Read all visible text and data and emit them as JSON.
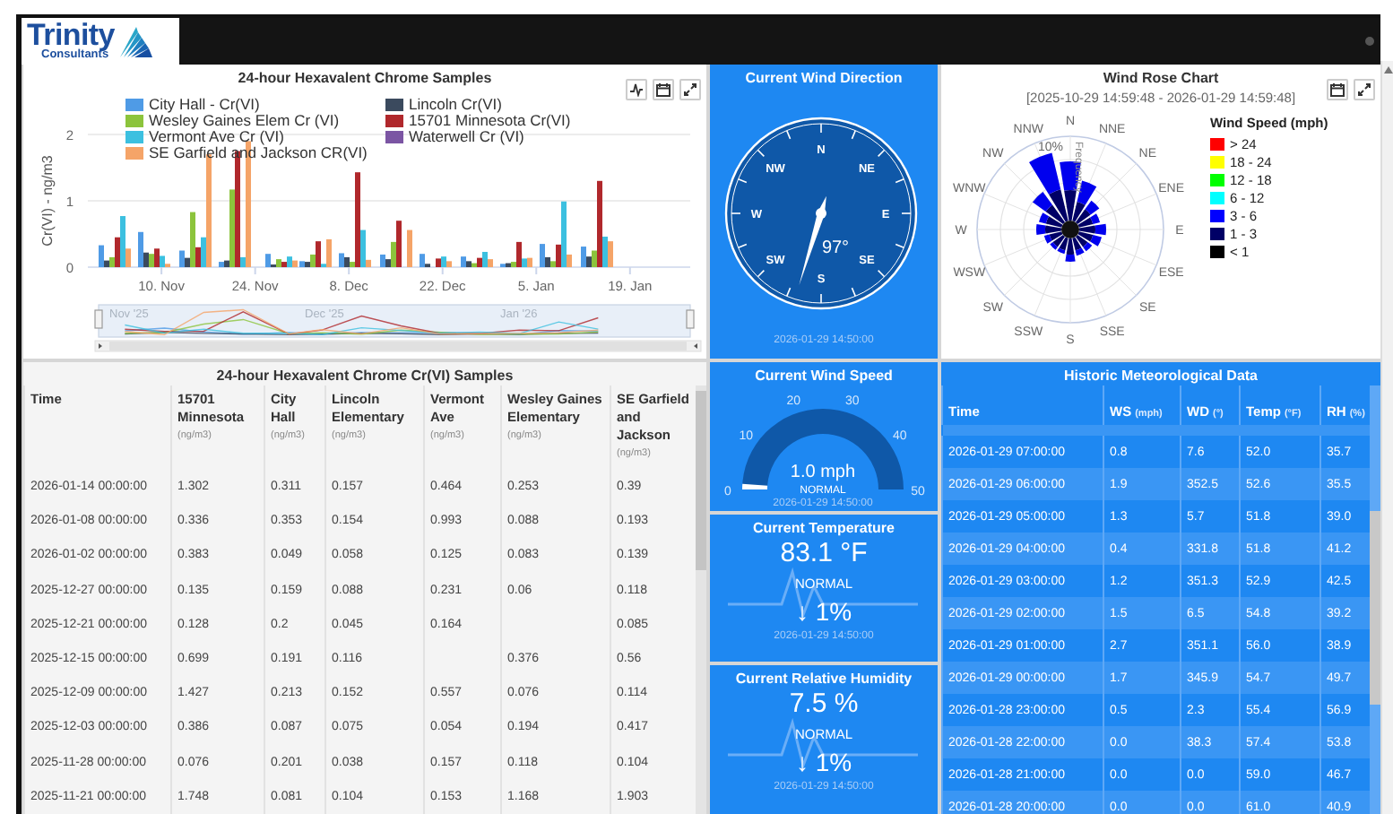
{
  "header": {
    "logo_text": "Trinity",
    "logo_subtext": "Consultants"
  },
  "samples_chart": {
    "chart_data": {
      "type": "bar",
      "title": "24-hour Hexavalent Chrome Samples",
      "ylabel": "Cr(VI) - ng/m3",
      "x": [
        "2025-11-03",
        "2025-11-09",
        "2025-11-15",
        "2025-11-21",
        "2025-11-28",
        "2025-12-03",
        "2025-12-09",
        "2025-12-15",
        "2025-12-21",
        "2025-12-27",
        "2026-01-02",
        "2026-01-08",
        "2026-01-14"
      ],
      "series": [
        {
          "name": "City Hall - Cr(VI)",
          "color": "#4f9be6",
          "values": [
            0.33,
            0.53,
            0.25,
            0.08,
            0.2,
            0.09,
            0.21,
            0.19,
            0.2,
            0.16,
            0.05,
            0.35,
            0.31
          ]
        },
        {
          "name": "Lincoln Cr(VI)",
          "color": "#3b4a5e",
          "values": [
            0.1,
            0.22,
            0.14,
            0.1,
            0.04,
            0.08,
            0.15,
            0.12,
            0.05,
            0.09,
            0.06,
            0.15,
            0.16
          ]
        },
        {
          "name": "Wesley Gaines Elem Cr (VI)",
          "color": "#8cc43c",
          "values": [
            0.15,
            0.2,
            0.83,
            1.17,
            0.12,
            0.19,
            0.08,
            0.38,
            null,
            0.06,
            0.08,
            0.09,
            0.25
          ]
        },
        {
          "name": "15701 Minnesota Cr(VI)",
          "color": "#b0282c",
          "values": [
            0.45,
            0.28,
            0.3,
            1.75,
            0.08,
            0.39,
            1.43,
            0.7,
            0.13,
            0.14,
            0.38,
            0.34,
            1.3
          ]
        },
        {
          "name": "Vermont Ave Cr (VI)",
          "color": "#3cc0e0",
          "values": [
            0.77,
            0.17,
            0.45,
            0.15,
            0.16,
            0.05,
            0.56,
            null,
            0.16,
            0.23,
            0.13,
            0.99,
            0.46
          ]
        },
        {
          "name": "Waterwell Cr (VI)",
          "color": "#7b55a3",
          "values": [
            null,
            null,
            null,
            null,
            null,
            null,
            null,
            null,
            null,
            null,
            null,
            null,
            null
          ]
        },
        {
          "name": "SE Garfield and Jackson CR(VI)",
          "color": "#f5a468",
          "values": [
            0.28,
            0.05,
            1.7,
            1.9,
            0.1,
            0.42,
            0.11,
            0.56,
            0.09,
            0.12,
            0.14,
            0.19,
            0.39
          ]
        }
      ],
      "xlim": [
        "2025-10-30",
        "2026-01-28"
      ],
      "ylim": [
        0,
        2
      ],
      "yticks": [
        0,
        1,
        2
      ],
      "xticks": [
        {
          "value": "2025-11-10",
          "label": "10. Nov"
        },
        {
          "value": "2025-11-24",
          "label": "24. Nov"
        },
        {
          "value": "2025-12-08",
          "label": "8. Dec"
        },
        {
          "value": "2025-12-22",
          "label": "22. Dec"
        },
        {
          "value": "2026-01-05",
          "label": "5. Jan"
        },
        {
          "value": "2026-01-19",
          "label": "19. Jan"
        }
      ]
    },
    "navigator_labels": [
      "Nov '25",
      "Dec '25",
      "Jan '26"
    ]
  },
  "wind_direction": {
    "title": "Current Wind Direction",
    "labels": [
      "N",
      "NE",
      "E",
      "SE",
      "S",
      "SW",
      "W",
      "NW"
    ],
    "value": "97°",
    "timestamp": "2026-01-29 14:50:00"
  },
  "wind_rose": {
    "title": "Wind Rose Chart",
    "subtitle": "[2025-10-29 14:59:48 - 2026-01-29 14:59:48]",
    "directions_right": [
      "N",
      "NNE",
      "NE",
      "ENE",
      "E",
      "ESE",
      "SE",
      "SSE",
      "S"
    ],
    "directions_left": [
      "NNW",
      "NW",
      "WNW",
      "W",
      "WSW",
      "SW",
      "SSW"
    ],
    "ring_label": "10%",
    "axis_label": "Frequency",
    "legend_title": "Wind Speed (mph)",
    "legend": [
      {
        "label": "> 24",
        "color": "#ff0000"
      },
      {
        "label": "18 - 24",
        "color": "#ffff00"
      },
      {
        "label": "12 - 18",
        "color": "#00ff00"
      },
      {
        "label": "6 - 12",
        "color": "#00ffff"
      },
      {
        "label": "3 - 6",
        "color": "#0000ff"
      },
      {
        "label": "1 - 3",
        "color": "#000066"
      },
      {
        "label": "< 1",
        "color": "#000000"
      }
    ]
  },
  "samples_table": {
    "title": "24-hour Hexavalent Chrome Cr(VI) Samples",
    "columns": [
      {
        "label": "Time"
      },
      {
        "label": "15701 Minnesota",
        "unit": "(ng/m3)"
      },
      {
        "label": "City Hall",
        "unit": "(ng/m3)"
      },
      {
        "label": "Lincoln Elementary",
        "unit": "(ng/m3)"
      },
      {
        "label": "Vermont Ave",
        "unit": "(ng/m3)"
      },
      {
        "label": "Wesley Gaines Elementary",
        "unit": "(ng/m3)"
      },
      {
        "label": "SE Garfield and Jackson",
        "unit": "(ng/m3)"
      }
    ],
    "rows": [
      [
        "2026-01-14 00:00:00",
        "1.302",
        "0.311",
        "0.157",
        "0.464",
        "0.253",
        "0.39"
      ],
      [
        "2026-01-08 00:00:00",
        "0.336",
        "0.353",
        "0.154",
        "0.993",
        "0.088",
        "0.193"
      ],
      [
        "2026-01-02 00:00:00",
        "0.383",
        "0.049",
        "0.058",
        "0.125",
        "0.083",
        "0.139"
      ],
      [
        "2025-12-27 00:00:00",
        "0.135",
        "0.159",
        "0.088",
        "0.231",
        "0.06",
        "0.118"
      ],
      [
        "2025-12-21 00:00:00",
        "0.128",
        "0.2",
        "0.045",
        "0.164",
        "",
        "0.085"
      ],
      [
        "2025-12-15 00:00:00",
        "0.699",
        "0.191",
        "0.116",
        "",
        "0.376",
        "0.56"
      ],
      [
        "2025-12-09 00:00:00",
        "1.427",
        "0.213",
        "0.152",
        "0.557",
        "0.076",
        "0.114"
      ],
      [
        "2025-12-03 00:00:00",
        "0.386",
        "0.087",
        "0.075",
        "0.054",
        "0.194",
        "0.417"
      ],
      [
        "2025-11-28 00:00:00",
        "0.076",
        "0.201",
        "0.038",
        "0.157",
        "0.118",
        "0.104"
      ],
      [
        "2025-11-21 00:00:00",
        "1.748",
        "0.081",
        "0.104",
        "0.153",
        "1.168",
        "1.903"
      ]
    ]
  },
  "wind_speed": {
    "title": "Current Wind Speed",
    "ticks": [
      "0",
      "10",
      "20",
      "30",
      "40",
      "50"
    ],
    "value": "1.0 mph",
    "status": "NORMAL",
    "timestamp": "2026-01-29 14:50:00"
  },
  "temperature": {
    "title": "Current Temperature",
    "value": "83.1 °F",
    "status": "NORMAL",
    "change": "↓ 1%",
    "timestamp": "2026-01-29 14:50:00"
  },
  "humidity": {
    "title": "Current Relative Humidity",
    "value": "7.5 %",
    "status": "NORMAL",
    "change": "↓ 1%",
    "timestamp": "2026-01-29 14:50:00"
  },
  "met_table": {
    "title": "Historic Meteorological Data",
    "columns": [
      {
        "label": "Time"
      },
      {
        "label": "WS",
        "unit": "(mph)"
      },
      {
        "label": "WD",
        "unit": "(°)"
      },
      {
        "label": "Temp",
        "unit": "(°F)"
      },
      {
        "label": "RH",
        "unit": "(%)"
      }
    ],
    "rows": [
      [
        "2026-01-29 07:00:00",
        "0.8",
        "7.6",
        "52.0",
        "35.7"
      ],
      [
        "2026-01-29 06:00:00",
        "1.9",
        "352.5",
        "52.6",
        "35.5"
      ],
      [
        "2026-01-29 05:00:00",
        "1.3",
        "5.7",
        "51.8",
        "39.0"
      ],
      [
        "2026-01-29 04:00:00",
        "0.4",
        "331.8",
        "51.8",
        "41.2"
      ],
      [
        "2026-01-29 03:00:00",
        "1.2",
        "351.3",
        "52.9",
        "42.5"
      ],
      [
        "2026-01-29 02:00:00",
        "1.5",
        "6.5",
        "54.8",
        "39.2"
      ],
      [
        "2026-01-29 01:00:00",
        "2.7",
        "351.1",
        "56.0",
        "38.9"
      ],
      [
        "2026-01-29 00:00:00",
        "1.7",
        "345.9",
        "54.7",
        "49.7"
      ],
      [
        "2026-01-28 23:00:00",
        "0.5",
        "2.3",
        "55.4",
        "56.9"
      ],
      [
        "2026-01-28 22:00:00",
        "0.0",
        "38.3",
        "57.4",
        "53.8"
      ],
      [
        "2026-01-28 21:00:00",
        "0.0",
        "0.0",
        "59.0",
        "46.7"
      ],
      [
        "2026-01-28 20:00:00",
        "0.0",
        "0.0",
        "61.0",
        "40.9"
      ]
    ]
  }
}
